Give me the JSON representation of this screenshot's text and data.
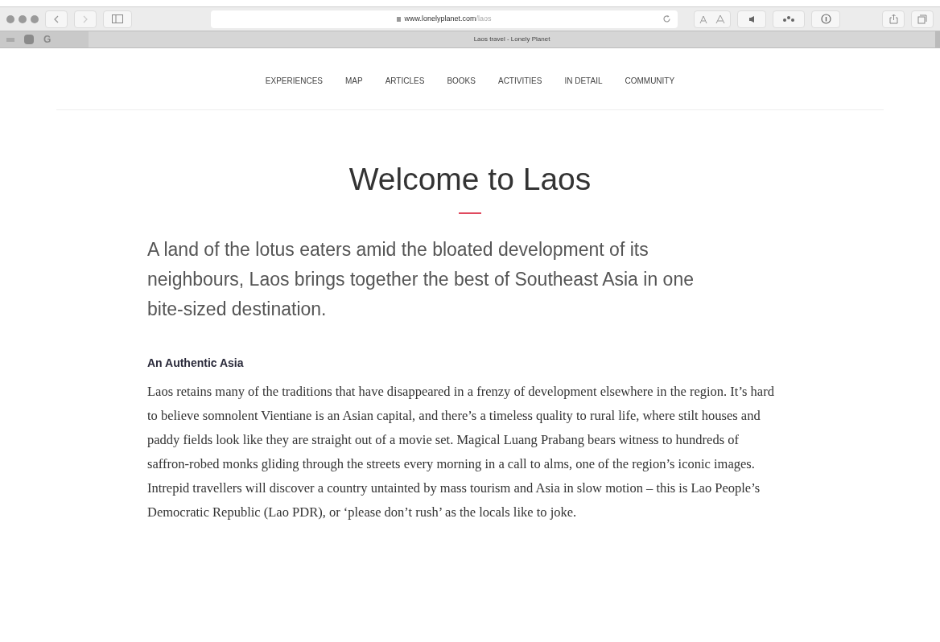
{
  "browser": {
    "url_host": "www.lonelyplanet.com",
    "url_path": "/laos",
    "tab_title": "Laos travel - Lonely Planet",
    "bookmark_letter": "G"
  },
  "nav": [
    "EXPERIENCES",
    "MAP",
    "ARTICLES",
    "BOOKS",
    "ACTIVITIES",
    "IN DETAIL",
    "COMMUNITY"
  ],
  "title": "Welcome to Laos",
  "lead": "A land of the lotus eaters amid the bloated development of its neighbours, Laos brings together the best of Southeast Asia in one bite-sized destination.",
  "section": {
    "heading": "An Authentic Asia",
    "body": "Laos retains many of the traditions that have disappeared in a frenzy of development elsewhere in the region. It’s hard to believe somnolent Vientiane is an Asian capital, and there’s a timeless quality to rural life, where stilt houses and paddy fields look like they are straight out of a movie set. Magical Luang Prabang bears witness to hundreds of saffron-robed monks gliding through the streets every morning in a call to alms, one of the region’s iconic images. Intrepid travellers will discover a country untainted by mass tourism and Asia in slow motion – this is Lao People’s Democratic Republic (Lao PDR), or ‘please don’t rush’ as the locals like to joke."
  }
}
